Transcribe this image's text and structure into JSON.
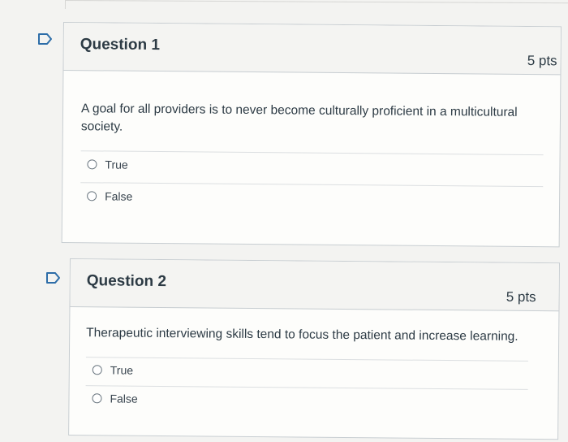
{
  "questions": [
    {
      "title": "Question 1",
      "points": "5 pts",
      "text": "A goal for all providers is to never become culturally proficient in a multicultural society.",
      "options": [
        "True",
        "False"
      ]
    },
    {
      "title": "Question 2",
      "points": "5 pts",
      "text": "Therapeutic interviewing skills tend to focus the patient and increase learning.",
      "options": [
        "True",
        "False"
      ]
    }
  ],
  "icons": {
    "flag": "flag-icon"
  },
  "colors": {
    "flag_stroke": "#2d6da8",
    "border": "#c7cdd1",
    "text": "#2d3b45"
  }
}
